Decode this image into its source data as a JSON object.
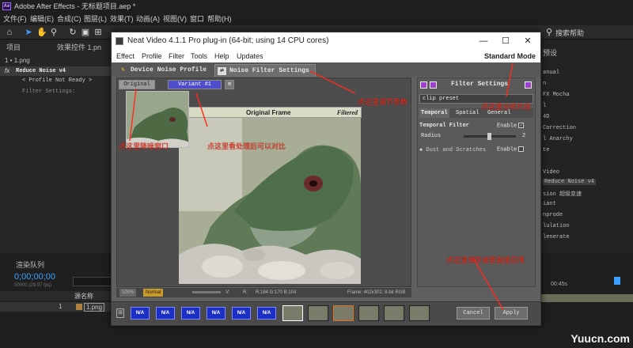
{
  "ae": {
    "window_title": "Adobe After Effects - 无标题项目.aep *",
    "menu": [
      "文件(F)",
      "编辑(E)",
      "合成(C)",
      "图层(L)",
      "效果(T)",
      "动画(A)",
      "视图(V)",
      "窗口",
      "帮助(H)"
    ],
    "search_label": "搜索帮助",
    "project_tab": "项目",
    "effects_tab": "效果控件 1.pn",
    "comp_label": "1 • 1.png",
    "effect_name": "Reduce Noise v4",
    "profile_line": "< Profile Not Ready >",
    "filter_settings": "Filter Settings:",
    "render_queue": "渲染队列",
    "timecode": "0;00;00;00",
    "fps": "00000 (29.97 fps)",
    "layer_name_header": "源名称",
    "layer_index": "1",
    "layer_name": "1.png",
    "right_panel": {
      "title": "预设",
      "items": [
        "anual",
        "n",
        "FX Mocha",
        "l",
        "4D",
        "Correction",
        "l Anarchy",
        "te",
        "",
        "Video",
        "Reduce Noise v4",
        "sion 超级变速",
        "iant",
        "nprode",
        "lulation",
        "lenerate"
      ]
    },
    "time_ruler": "00:45s"
  },
  "nv": {
    "title": "Neat Video 4.1.1 Pro plug-in (64-bit; using 14 CPU cores)",
    "menu": [
      "Effect",
      "Profile",
      "Filter",
      "Tools",
      "Help",
      "Updates"
    ],
    "mode": "Standard Mode",
    "tab_device": "Device Noise Profile",
    "tab_filter": "Noise Filter Settings",
    "btn_original": "Original",
    "btn_variant": "Variant #1",
    "original_frame": "Original Frame",
    "filtered": "Filtered",
    "status": {
      "zoom": "100%",
      "view": "Normal",
      "v": "V:",
      "r": "R:",
      "coords": "R:184 G:170 B:104",
      "frame": "Frame: 402x302, 8-bit RGB"
    },
    "filter_panel": {
      "title": "Filter Settings",
      "preset": "clip preset",
      "tab_temporal": "Temporal",
      "tab_spatial": "Spatial",
      "tab_general": "General",
      "temporal_filter": "Temporal Filter",
      "enable": "Enable",
      "radius": "Radius",
      "radius_value": "2",
      "radius_fraction": 0.45,
      "dust": "Dust and Scratches",
      "enable2": "Enable"
    },
    "filmstrip": {
      "na": [
        "N/A",
        "N/A",
        "N/A",
        "N/A",
        "N/A",
        "N/A"
      ],
      "cancel": "Cancel",
      "apply": "Apply"
    }
  },
  "annotations": {
    "a1": "点这里降噪窗口",
    "a2": "点这里看处理后可以对比",
    "a3": "点这里调节参数",
    "a4": "点这里分析片段",
    "a5": "点这里保存或者直接应用",
    "a6": "点这里确定",
    "color": "#ff2a1a"
  },
  "watermark": "Yuucn.com"
}
